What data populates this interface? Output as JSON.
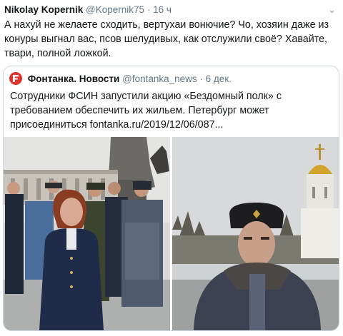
{
  "tweet": {
    "author_name": "Nikolay Kopernik",
    "handle": "@Kopernik75",
    "separator": "·",
    "time": "16 ч",
    "caret": "⌄",
    "text": "А нахуй не желаете сходить, вертухаи вонючие? Чо, хозяин даже из конуры выгнал вас, псов шелудивых, как отслужили своё? Хавайте, твари, полной ложкой."
  },
  "quote": {
    "author_name": "Фонтанка. Новости",
    "handle": "@fontanka_news",
    "separator": "·",
    "time": "6 дек.",
    "text": "Сотрудники ФСИН запустили акцию «Бездомный полк» с требованием обеспечить их жильем. Петербург может присоединиться  fontanka.ru/2019/12/06/087...",
    "logo_color": "#e2332e"
  },
  "media": {
    "left_photo": "group-of-officers-photo",
    "right_photo": "officer-in-fur-hat-photo"
  }
}
